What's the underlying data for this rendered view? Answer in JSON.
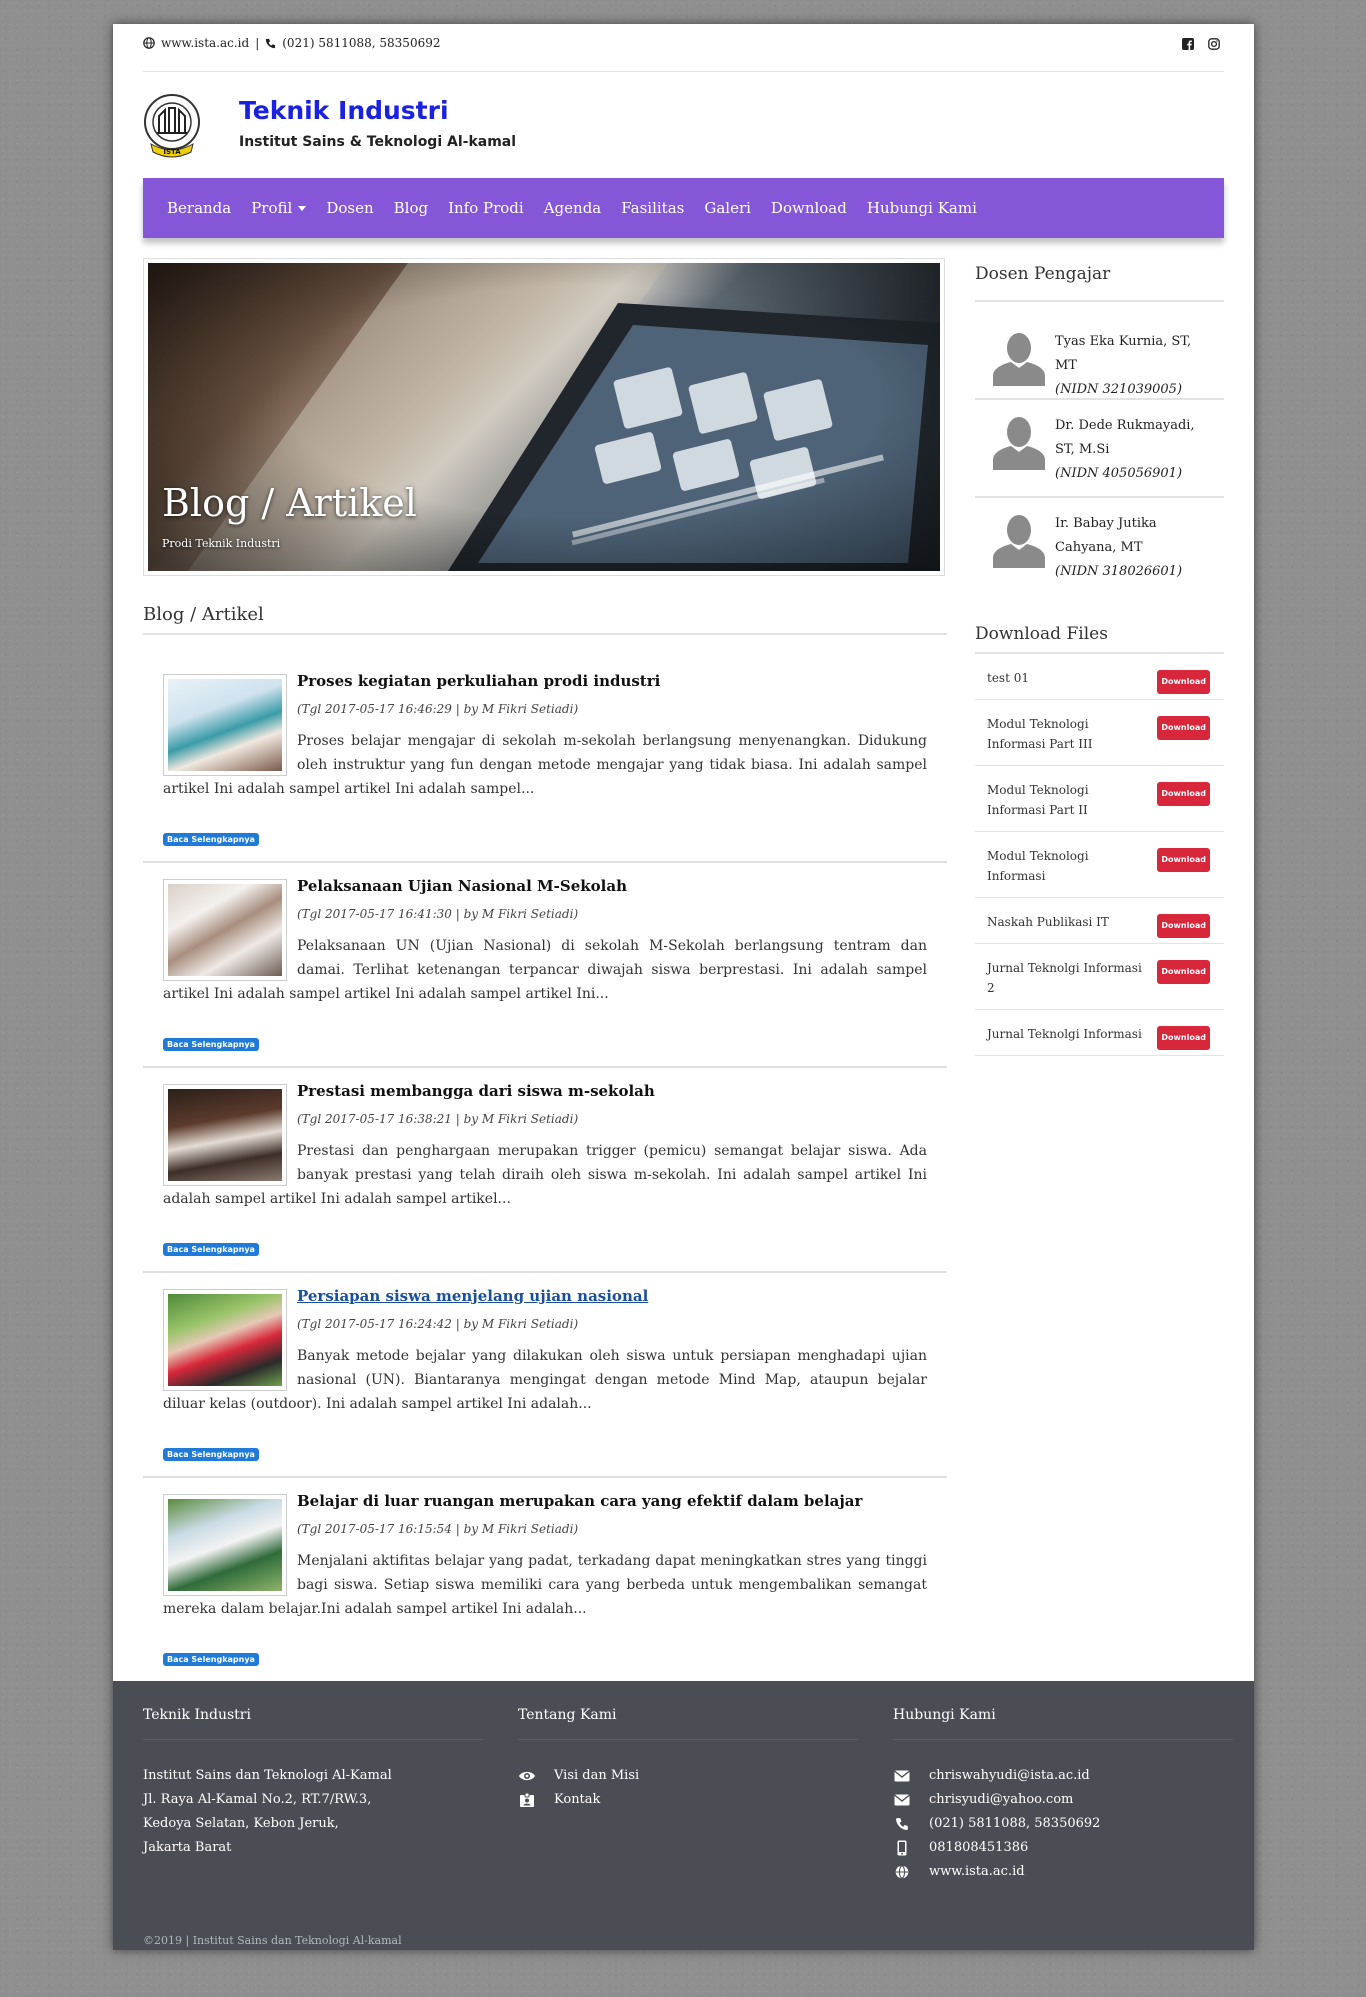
{
  "topbar": {
    "website": "www.ista.ac.id",
    "separator": "|",
    "phone": "(021) 5811088, 58350692"
  },
  "brand": {
    "title": "Teknik Industri",
    "subtitle": "Institut Sains & Teknologi Al-kamal",
    "logo_text": "ISTA"
  },
  "nav": {
    "items": [
      "Beranda",
      "Profil",
      "Dosen",
      "Blog",
      "Info Prodi",
      "Agenda",
      "Fasilitas",
      "Galeri",
      "Download",
      "Hubungi Kami"
    ]
  },
  "hero": {
    "title": "Blog / Artikel",
    "subtitle": "Prodi Teknik Industri"
  },
  "blog": {
    "heading": "Blog / Artikel",
    "read_more": "Baca Selengkapnya",
    "articles": [
      {
        "title": "Proses kegiatan perkuliahan prodi industri",
        "meta": "(Tgl 2017-05-17 16:46:29 | by M Fikri Setiadi)",
        "excerpt": "Proses belajar mengajar di sekolah m-sekolah berlangsung menyenangkan. Didukung oleh instruktur yang fun dengan metode mengajar yang tidak biasa. Ini adalah sampel artikel Ini adalah sampel artikel Ini adalah sampel..."
      },
      {
        "title": "Pelaksanaan Ujian Nasional M-Sekolah",
        "meta": "(Tgl 2017-05-17 16:41:30 | by M Fikri Setiadi)",
        "excerpt": "Pelaksanaan UN (Ujian Nasional) di sekolah M-Sekolah berlangsung tentram dan damai. Terlihat ketenangan terpancar diwajah siswa berprestasi.  Ini adalah sampel artikel Ini adalah sampel artikel  Ini adalah sampel artikel Ini..."
      },
      {
        "title": "Prestasi membangga dari siswa m-sekolah",
        "meta": "(Tgl 2017-05-17 16:38:21 | by M Fikri Setiadi)",
        "excerpt": "Prestasi dan penghargaan merupakan trigger (pemicu) semangat belajar siswa. Ada banyak prestasi yang telah diraih oleh siswa m-sekolah. Ini adalah sampel artikel Ini adalah sampel artikel Ini adalah sampel artikel..."
      },
      {
        "title": "Persiapan siswa menjelang ujian nasional",
        "meta": "(Tgl 2017-05-17 16:24:42 | by M Fikri Setiadi)",
        "excerpt": "Banyak metode bejalar yang dilakukan oleh siswa untuk persiapan menghadapi ujian nasional (UN). Biantaranya mengingat dengan metode Mind Map, ataupun bejalar diluar kelas (outdoor).  Ini adalah sampel artikel Ini adalah..."
      },
      {
        "title": "Belajar di luar ruangan merupakan cara yang efektif dalam belajar",
        "meta": "(Tgl 2017-05-17 16:15:54 | by M Fikri Setiadi)",
        "excerpt": "Menjalani aktifitas belajar yang padat, terkadang dapat meningkatkan stres yang tinggi bagi siswa. Setiap siswa memiliki cara yang berbeda untuk mengembalikan semangat mereka dalam belajar.Ini adalah sampel artikel Ini adalah..."
      }
    ]
  },
  "sidebar": {
    "dosen_heading": "Dosen Pengajar",
    "dosen": [
      {
        "name": "Tyas Eka Kurnia, ST, MT",
        "nidn": "(NIDN 321039005)"
      },
      {
        "name": "Dr. Dede Rukmayadi, ST, M.Si",
        "nidn": "(NIDN 405056901)"
      },
      {
        "name": "Ir. Babay Jutika Cahyana, MT",
        "nidn": "(NIDN 318026601)"
      }
    ],
    "files_heading": "Download Files",
    "download_label": "Download",
    "files": [
      "test 01",
      "Modul Teknologi Informasi Part III",
      "Modul Teknologi Informasi Part II",
      "Modul Teknologi Informasi",
      "Naskah Publikasi IT",
      "Jurnal Teknolgi Informasi 2",
      "Jurnal Teknolgi Informasi"
    ]
  },
  "footer": {
    "col1": {
      "heading": "Teknik Industri",
      "lines": [
        "Institut Sains dan Teknologi Al-Kamal",
        "Jl. Raya Al-Kamal No.2, RT.7/RW.3,",
        "Kedoya Selatan, Kebon Jeruk,",
        "Jakarta Barat"
      ]
    },
    "col2": {
      "heading": "Tentang Kami",
      "links": [
        {
          "icon": "eye-icon",
          "label": "Visi dan Misi"
        },
        {
          "icon": "contact-card-icon",
          "label": "Kontak"
        }
      ]
    },
    "col3": {
      "heading": "Hubungi Kami",
      "items": [
        {
          "icon": "envelope-icon",
          "label": "chriswahyudi@ista.ac.id"
        },
        {
          "icon": "envelope-icon",
          "label": "chrisyudi@yahoo.com"
        },
        {
          "icon": "phone-icon",
          "label": "(021) 5811088, 58350692"
        },
        {
          "icon": "mobile-icon",
          "label": "081808451386"
        },
        {
          "icon": "globe-icon",
          "label": "www.ista.ac.id"
        }
      ]
    },
    "copyright": "©2019 | Institut Sains dan Teknologi Al-kamal"
  },
  "colors": {
    "nav_bg": "#8557d8",
    "brand_title": "#1a22e0",
    "read_more_badge": "#1f7ad8",
    "download_badge": "#d8263b",
    "footer_bg": "#4a4e54"
  }
}
